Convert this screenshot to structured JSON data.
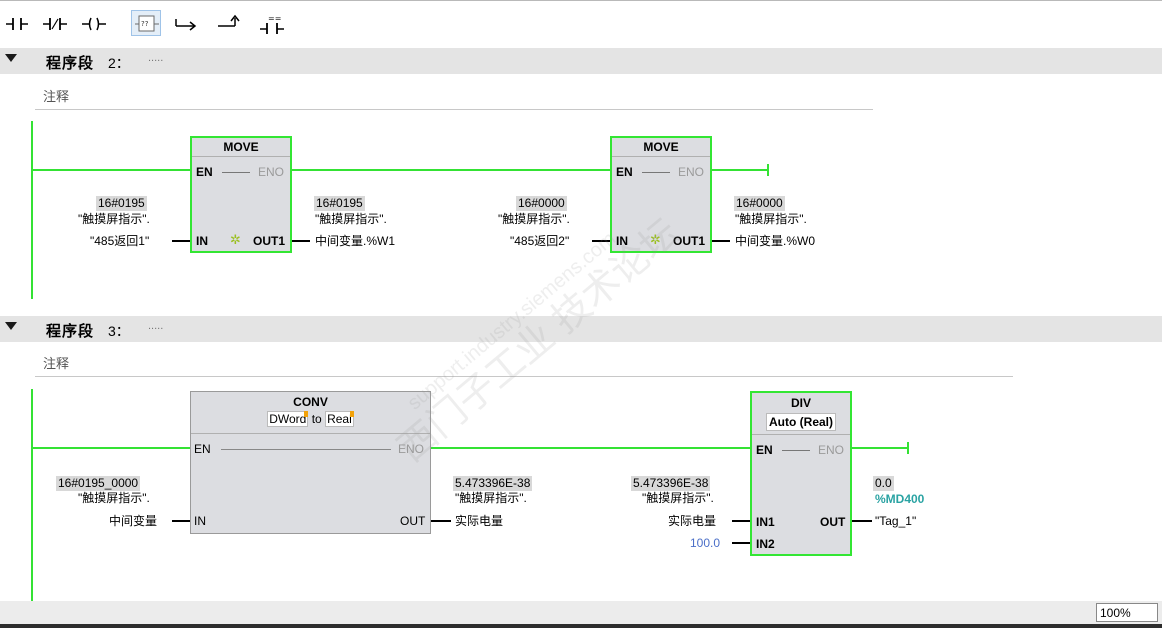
{
  "toolbar": {
    "buttons": [
      {
        "name": "no-contact-button",
        "icon": "no-contact-icon"
      },
      {
        "name": "nc-contact-button",
        "icon": "nc-contact-icon"
      },
      {
        "name": "coil-button",
        "icon": "coil-icon"
      },
      {
        "name": "empty-box-button",
        "icon": "empty-box-icon",
        "glyph": "??"
      },
      {
        "name": "open-branch-button",
        "icon": "open-branch-icon"
      },
      {
        "name": "close-branch-button",
        "icon": "close-branch-icon"
      },
      {
        "name": "compare-button",
        "icon": "compare-icon",
        "glyph": "=="
      }
    ]
  },
  "networks": [
    {
      "title": "程序段",
      "number": "2：",
      "dots": ".....",
      "comment": "注释",
      "blocks": [
        {
          "name": "MOVE",
          "en": "EN",
          "eno": "ENO",
          "in": "IN",
          "out": "OUT1",
          "in_value": "16#0195",
          "in_tag_1": "\"触摸屏指示\".",
          "in_tag_2": "\"485返回1\"",
          "out_value": "16#0195",
          "out_tag_1": "\"触摸屏指示\".",
          "out_tag_2": "中间变量.%W1"
        },
        {
          "name": "MOVE",
          "en": "EN",
          "eno": "ENO",
          "in": "IN",
          "out": "OUT1",
          "in_value": "16#0000",
          "in_tag_1": "\"触摸屏指示\".",
          "in_tag_2": "\"485返回2\"",
          "out_value": "16#0000",
          "out_tag_1": "\"触摸屏指示\".",
          "out_tag_2": "中间变量.%W0"
        }
      ]
    },
    {
      "title": "程序段",
      "number": "3：",
      "dots": ".....",
      "comment": "注释",
      "conv": {
        "name": "CONV",
        "from": "DWord",
        "to_word": "to",
        "to": "Real",
        "en": "EN",
        "eno": "ENO",
        "in": "IN",
        "out": "OUT",
        "in_value": "16#0195_0000",
        "in_tag_1": "\"触摸屏指示\".",
        "in_tag_2": "中间变量",
        "out_value": "5.473396E-38",
        "out_tag_1": "\"触摸屏指示\".",
        "out_tag_2": "实际电量"
      },
      "div": {
        "name": "DIV",
        "type": "Auto (Real)",
        "en": "EN",
        "eno": "ENO",
        "in1": "IN1",
        "in2": "IN2",
        "out": "OUT",
        "in1_value": "5.473396E-38",
        "in1_tag_1": "\"触摸屏指示\".",
        "in1_tag_2": "实际电量",
        "in2_value": "100.0",
        "out_value": "0.0",
        "out_addr": "%MD400",
        "out_tag": "\"Tag_1\""
      }
    }
  ],
  "status": {
    "zoom": "100%"
  },
  "watermark": {
    "cn": "西门子工业 技术论坛",
    "url": "support.industry.siemens.com"
  },
  "colors": {
    "accent_green": "#33e633",
    "rail_green": "#34e234",
    "address_teal": "#2aa3a3",
    "constant_blue": "#4b6fc8"
  }
}
